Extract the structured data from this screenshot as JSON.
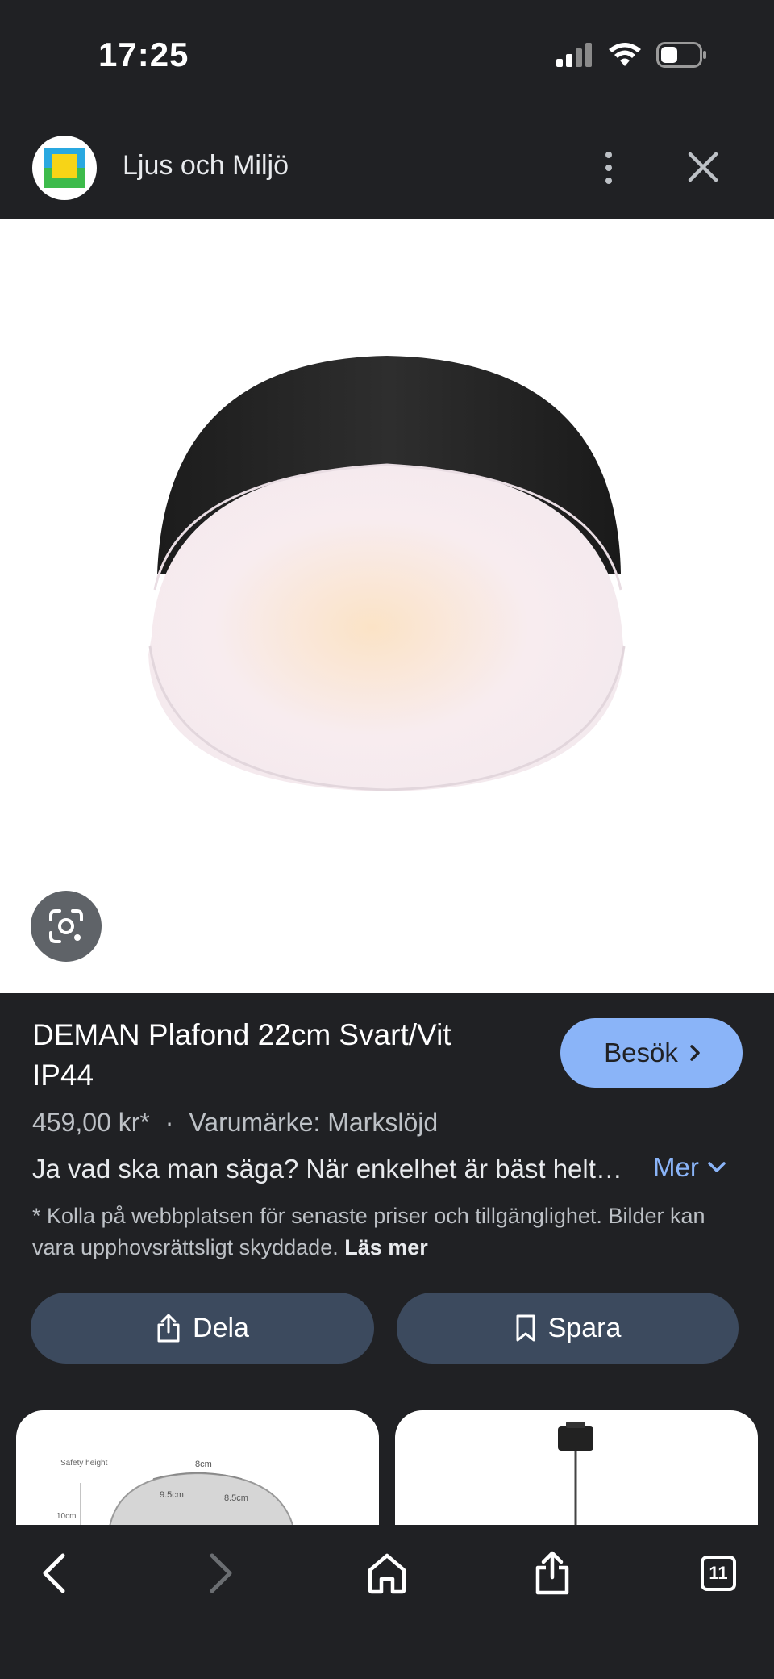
{
  "status_bar": {
    "time": "17:25",
    "signal_icon": "cellular-signal-icon",
    "wifi_icon": "wifi-icon",
    "battery_icon": "battery-icon"
  },
  "header": {
    "site_name": "Ljus och Miljö",
    "logo_icon": "site-logo-icon",
    "menu_icon": "more-vertical-icon",
    "close_icon": "close-icon"
  },
  "image": {
    "lens_icon": "google-lens-icon"
  },
  "product": {
    "title": "DEMAN Plafond 22cm Svart/Vit IP44",
    "price": "459,00 kr*",
    "separator": "·",
    "brand": "Varumärke: Markslöjd",
    "description": "Ja vad ska man säga? När enkelhet är bäst helt…",
    "more_label": "Mer",
    "disclaimer": "* Kolla på webbplatsen för senaste priser och tillgänglighet. Bilder kan vara upphovsrättsligt skyddade.",
    "read_more": "Läs mer",
    "visit_label": "Besök"
  },
  "actions": {
    "share_label": "Dela",
    "save_label": "Spara"
  },
  "thumbnails": {
    "thumb1_labels": [
      "Safety height",
      "8cm",
      "9.5cm",
      "8.5cm",
      "10cm"
    ]
  },
  "toolbar": {
    "tab_count": "11",
    "icons": [
      "back-icon",
      "forward-icon",
      "home-icon",
      "share-icon",
      "tabs-icon"
    ]
  },
  "colors": {
    "background": "#202124",
    "accent": "#8ab4f8",
    "button": "#3c4a5e"
  }
}
